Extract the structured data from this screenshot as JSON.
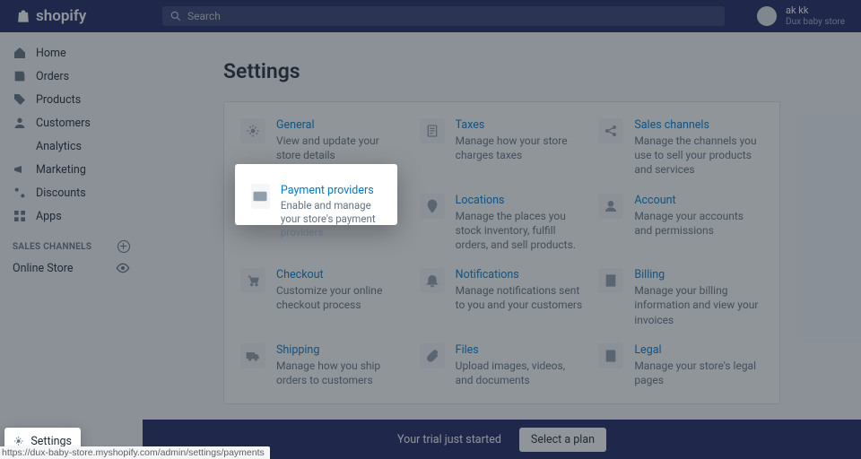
{
  "brand": "shopify",
  "search": {
    "placeholder": "Search"
  },
  "user": {
    "name": "ak kk",
    "store": "Dux baby store"
  },
  "nav": {
    "items": [
      {
        "label": "Home"
      },
      {
        "label": "Orders"
      },
      {
        "label": "Products"
      },
      {
        "label": "Customers"
      },
      {
        "label": "Analytics"
      },
      {
        "label": "Marketing"
      },
      {
        "label": "Discounts"
      },
      {
        "label": "Apps"
      }
    ],
    "channels_header": "SALES CHANNELS",
    "channels": [
      {
        "label": "Online Store"
      }
    ]
  },
  "settings_button": "Settings",
  "page": {
    "title": "Settings"
  },
  "tiles": {
    "general": {
      "title": "General",
      "desc": "View and update your store details"
    },
    "taxes": {
      "title": "Taxes",
      "desc": "Manage how your store charges taxes"
    },
    "channels": {
      "title": "Sales channels",
      "desc": "Manage the channels you use to sell your products and services"
    },
    "payment": {
      "title": "Payment providers",
      "desc": "Enable and manage your store's payment providers"
    },
    "locations": {
      "title": "Locations",
      "desc": "Manage the places you stock inventory, fulfill orders, and sell products."
    },
    "account": {
      "title": "Account",
      "desc": "Manage your accounts and permissions"
    },
    "checkout": {
      "title": "Checkout",
      "desc": "Customize your online checkout process"
    },
    "notifications": {
      "title": "Notifications",
      "desc": "Manage notifications sent to you and your customers"
    },
    "billing": {
      "title": "Billing",
      "desc": "Manage your billing information and view your invoices"
    },
    "shipping": {
      "title": "Shipping",
      "desc": "Manage how you ship orders to customers"
    },
    "files": {
      "title": "Files",
      "desc": "Upload images, videos, and documents"
    },
    "legal": {
      "title": "Legal",
      "desc": "Manage your store's legal pages"
    }
  },
  "footer": {
    "trial": "Your trial just started",
    "cta": "Select a plan"
  },
  "status_url": "https://dux-baby-store.myshopify.com/admin/settings/payments"
}
